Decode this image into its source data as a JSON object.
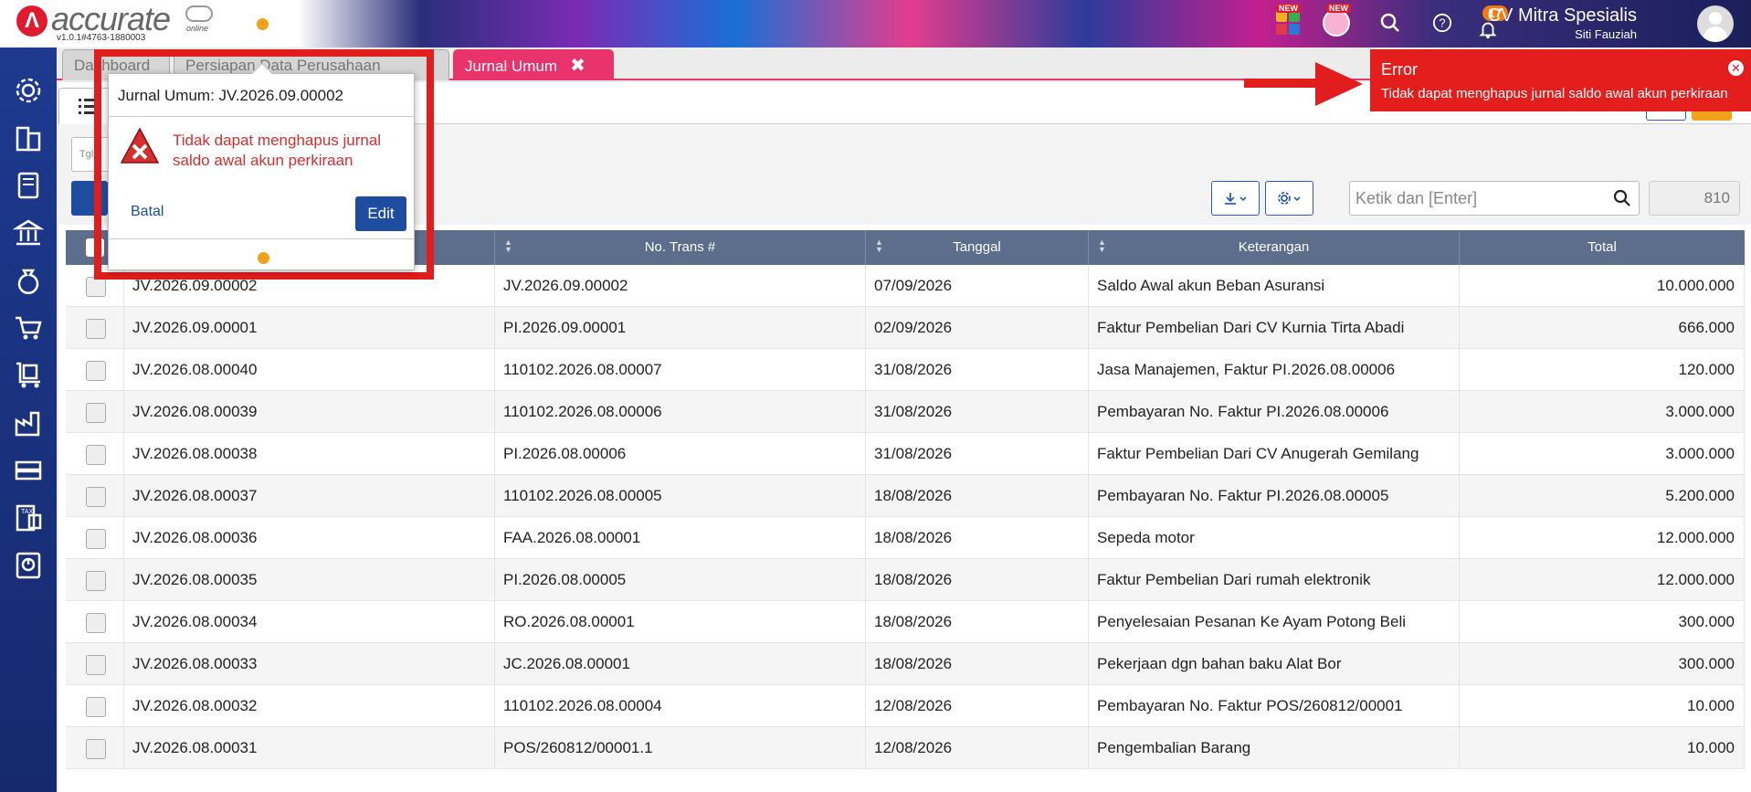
{
  "header": {
    "logo_letter": "Λ",
    "logo_text": "accurate",
    "logo_sub": "online",
    "version": "v1.0.1#4763-1880003",
    "new_badge_1": "NEW",
    "new_badge_2": "NEW",
    "notification_count": "17",
    "company_name": "CV Mitra Spesialis",
    "user_name": "Siti Fauziah"
  },
  "tabs": [
    {
      "label": "Dashboard"
    },
    {
      "label": "Persiapan Data Perusahaan"
    },
    {
      "label": "Jurnal Umum",
      "close": "✖"
    }
  ],
  "filter": {
    "date_placeholder": "Tgl",
    "search_placeholder": "Ketik dan [Enter]",
    "record_count": "810"
  },
  "table": {
    "headers": [
      "No. Trans #",
      "Tanggal",
      "Keterangan",
      "Total"
    ],
    "rows": [
      {
        "no": "JV.2026.09.00002",
        "trans": "JV.2026.09.00002",
        "date": "07/09/2026",
        "desc": "Saldo Awal akun Beban Asuransi",
        "total": "10.000.000"
      },
      {
        "no": "JV.2026.09.00001",
        "trans": "PI.2026.09.00001",
        "date": "02/09/2026",
        "desc": "Faktur Pembelian Dari CV Kurnia Tirta Abadi",
        "total": "666.000"
      },
      {
        "no": "JV.2026.08.00040",
        "trans": "110102.2026.08.00007",
        "date": "31/08/2026",
        "desc": "Jasa Manajemen, Faktur PI.2026.08.00006",
        "total": "120.000"
      },
      {
        "no": "JV.2026.08.00039",
        "trans": "110102.2026.08.00006",
        "date": "31/08/2026",
        "desc": "Pembayaran No. Faktur PI.2026.08.00006",
        "total": "3.000.000"
      },
      {
        "no": "JV.2026.08.00038",
        "trans": "PI.2026.08.00006",
        "date": "31/08/2026",
        "desc": "Faktur Pembelian Dari CV Anugerah Gemilang",
        "total": "3.000.000"
      },
      {
        "no": "JV.2026.08.00037",
        "trans": "110102.2026.08.00005",
        "date": "18/08/2026",
        "desc": "Pembayaran No. Faktur PI.2026.08.00005",
        "total": "5.200.000"
      },
      {
        "no": "JV.2026.08.00036",
        "trans": "FAA.2026.08.00001",
        "date": "18/08/2026",
        "desc": "Sepeda motor",
        "total": "12.000.000"
      },
      {
        "no": "JV.2026.08.00035",
        "trans": "PI.2026.08.00005",
        "date": "18/08/2026",
        "desc": "Faktur Pembelian Dari rumah elektronik",
        "total": "12.000.000"
      },
      {
        "no": "JV.2026.08.00034",
        "trans": "RO.2026.08.00001",
        "date": "18/08/2026",
        "desc": "Penyelesaian Pesanan Ke Ayam Potong Beli",
        "total": "300.000"
      },
      {
        "no": "JV.2026.08.00033",
        "trans": "JC.2026.08.00001",
        "date": "18/08/2026",
        "desc": "Pekerjaan dgn bahan baku Alat Bor",
        "total": "300.000"
      },
      {
        "no": "JV.2026.08.00032",
        "trans": "110102.2026.08.00004",
        "date": "12/08/2026",
        "desc": "Pembayaran No. Faktur POS/260812/00001",
        "total": "10.000"
      },
      {
        "no": "JV.2026.08.00031",
        "trans": "POS/260812/00001.1",
        "date": "12/08/2026",
        "desc": "Pengembalian Barang",
        "total": "10.000"
      }
    ]
  },
  "popup": {
    "title": "Jurnal Umum: JV.2026.09.00002",
    "message": "Tidak dapat menghapus jurnal saldo awal akun perkiraan",
    "cancel_label": "Batal",
    "edit_label": "Edit"
  },
  "error_toast": {
    "title": "Error",
    "message": "Tidak dapat menghapus jurnal saldo awal akun perkiraan",
    "close": "✕"
  },
  "colors": {
    "sidebar": "#1d3a8f",
    "active_tab": "#e8336d",
    "error": "#e41d1d",
    "primary_button": "#1e4da0",
    "table_header": "#5d6e8c"
  }
}
